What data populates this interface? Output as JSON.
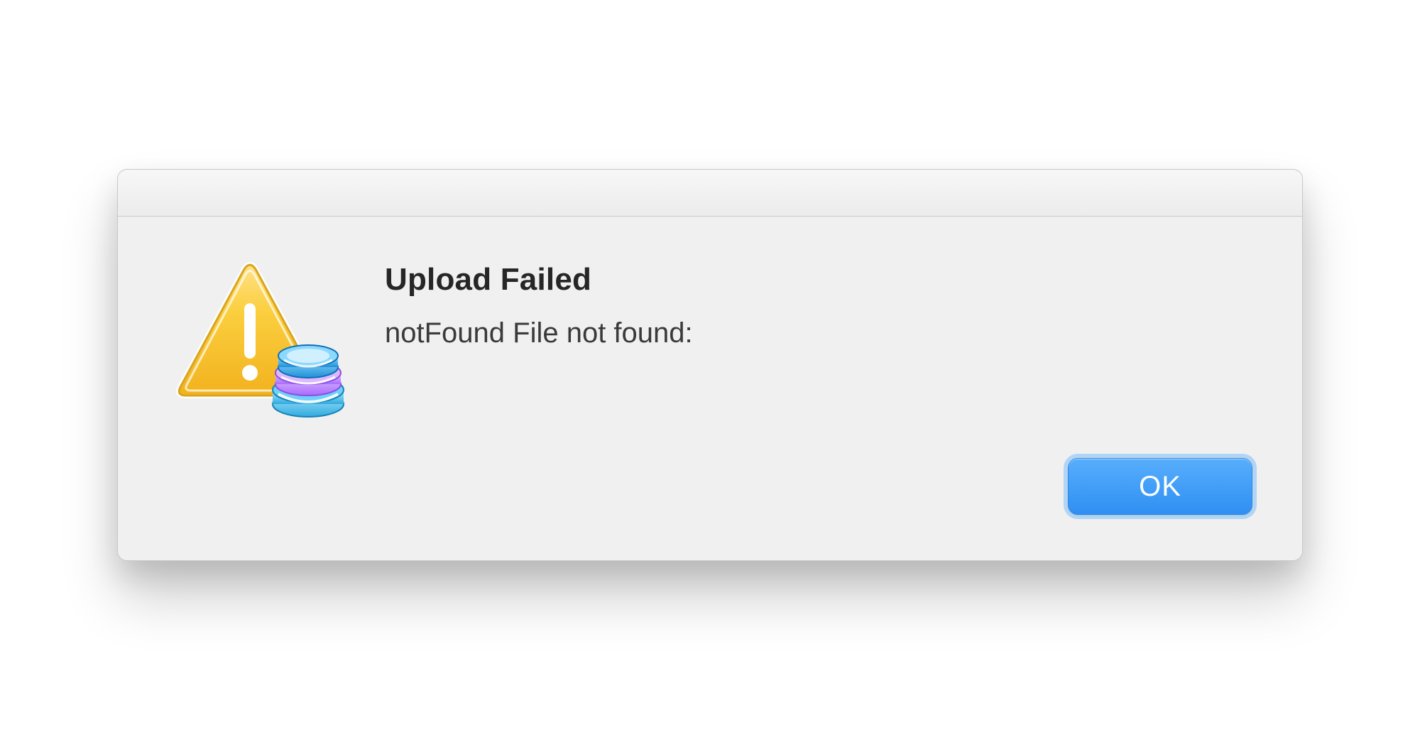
{
  "dialog": {
    "title": "Upload Failed",
    "message": "notFound File not found:",
    "ok_label": "OK"
  },
  "icons": {
    "alert": "warning-triangle-icon",
    "badge": "database-stack-icon"
  },
  "colors": {
    "window_bg": "#f0f0f0",
    "ok_button_bg_top": "#57aefc",
    "ok_button_bg_bottom": "#2f8ff2",
    "ok_button_focus_ring": "#40a0ff",
    "warning_fill": "#f7c22f",
    "warning_border": "#d9a51f",
    "disc1": "#2fa3e8",
    "disc2": "#c694ff",
    "disc3": "#39b7f2"
  }
}
